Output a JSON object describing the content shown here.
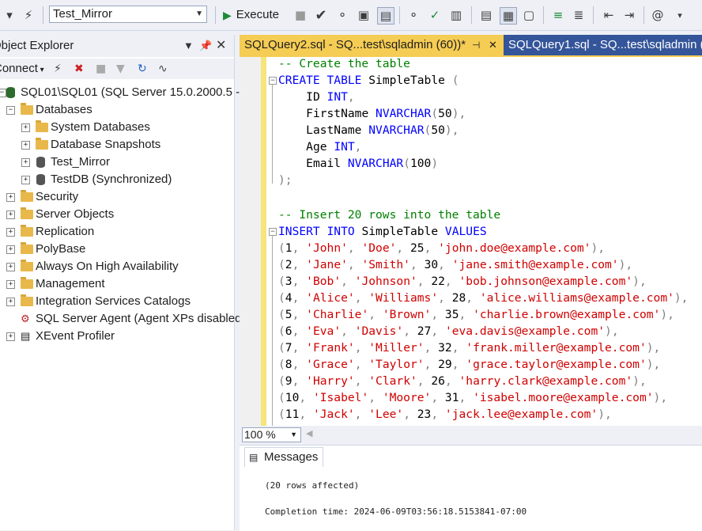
{
  "toolbar": {
    "database": "Test_Mirror",
    "execute_label": "Execute"
  },
  "object_explorer": {
    "title": "Object Explorer",
    "connect_label": "Connect",
    "server": "SQL01\\SQL01 (SQL Server 15.0.2000.5 - t",
    "nodes": {
      "databases": "Databases",
      "system_databases": "System Databases",
      "database_snapshots": "Database Snapshots",
      "test_mirror": "Test_Mirror",
      "testdb": "TestDB (Synchronized)",
      "security": "Security",
      "server_objects": "Server Objects",
      "replication": "Replication",
      "polybase": "PolyBase",
      "always_on": "Always On High Availability",
      "management": "Management",
      "integration_services": "Integration Services Catalogs",
      "sql_agent": "SQL Server Agent (Agent XPs disabled",
      "xevent": "XEvent Profiler"
    }
  },
  "tabs": {
    "active": "SQLQuery2.sql - SQ...test\\sqladmin (60))*",
    "inactive": "SQLQuery1.sql - SQ...test\\sqladmin (7"
  },
  "editor": {
    "l1": "-- Create the table",
    "l2_kw1": "CREATE",
    "l2_kw2": "TABLE",
    "l2_name": "SimpleTable",
    "col1": "ID",
    "col1_type": "INT",
    "col2": "FirstName",
    "col2_type": "NVARCHAR",
    "col2_len": "50",
    "col3": "LastName",
    "col3_type": "NVARCHAR",
    "col3_len": "50",
    "col4": "Age",
    "col4_type": "INT",
    "col5": "Email",
    "col5_type": "NVARCHAR",
    "col5_len": "100",
    "l9": "-- Insert 20 rows into the table",
    "l10_kw1": "INSERT",
    "l10_kw2": "INTO",
    "l10_name": "SimpleTable",
    "l10_kw3": "VALUES",
    "rows": [
      {
        "id": "1",
        "first": "'John'",
        "last": "'Doe'",
        "age": "25",
        "email": "'john.doe@example.com'"
      },
      {
        "id": "2",
        "first": "'Jane'",
        "last": "'Smith'",
        "age": "30",
        "email": "'jane.smith@example.com'"
      },
      {
        "id": "3",
        "first": "'Bob'",
        "last": "'Johnson'",
        "age": "22",
        "email": "'bob.johnson@example.com'"
      },
      {
        "id": "4",
        "first": "'Alice'",
        "last": "'Williams'",
        "age": "28",
        "email": "'alice.williams@example.com'"
      },
      {
        "id": "5",
        "first": "'Charlie'",
        "last": "'Brown'",
        "age": "35",
        "email": "'charlie.brown@example.com'"
      },
      {
        "id": "6",
        "first": "'Eva'",
        "last": "'Davis'",
        "age": "27",
        "email": "'eva.davis@example.com'"
      },
      {
        "id": "7",
        "first": "'Frank'",
        "last": "'Miller'",
        "age": "32",
        "email": "'frank.miller@example.com'"
      },
      {
        "id": "8",
        "first": "'Grace'",
        "last": "'Taylor'",
        "age": "29",
        "email": "'grace.taylor@example.com'"
      },
      {
        "id": "9",
        "first": "'Harry'",
        "last": "'Clark'",
        "age": "26",
        "email": "'harry.clark@example.com'"
      },
      {
        "id": "10",
        "first": "'Isabel'",
        "last": "'Moore'",
        "age": "31",
        "email": "'isabel.moore@example.com'"
      },
      {
        "id": "11",
        "first": "'Jack'",
        "last": "'Lee'",
        "age": "23",
        "email": "'jack.lee@example.com'"
      }
    ]
  },
  "zoom": "100 %",
  "results": {
    "tab_label": "Messages",
    "line1": "(20 rows affected)",
    "line2": "Completion time: 2024-06-09T03:56:18.5153841-07:00"
  }
}
